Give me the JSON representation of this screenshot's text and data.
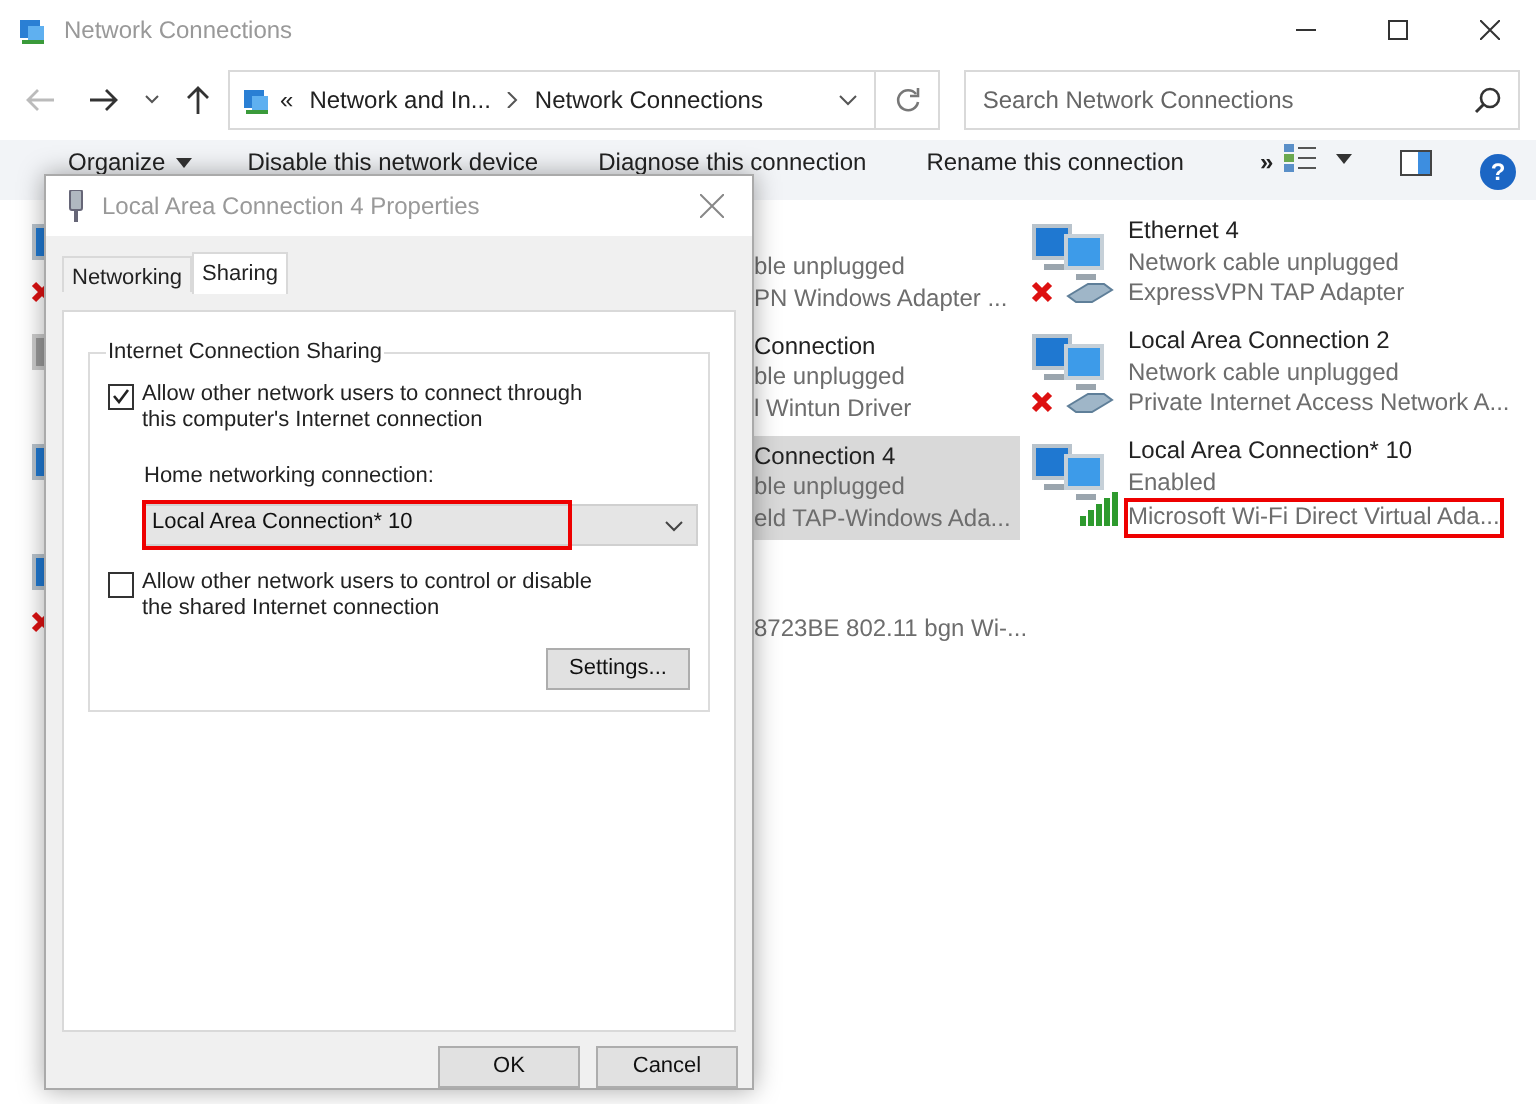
{
  "window": {
    "title": "Network Connections"
  },
  "address_bar": {
    "overflow": "«",
    "crumbs": [
      "Network and In...",
      "Network Connections"
    ]
  },
  "search": {
    "placeholder": "Search Network Connections"
  },
  "commands": [
    {
      "label": "Organize",
      "menu": true
    },
    {
      "label": "Disable this network device",
      "menu": false
    },
    {
      "label": "Diagnose this connection",
      "menu": false
    },
    {
      "label": "Rename this connection",
      "menu": false
    }
  ],
  "more_commands": "»",
  "help": "?",
  "columns": [
    {
      "items": [
        {
          "kind": "unplugged"
        },
        {
          "kind": "disabled"
        },
        {
          "kind": "enabled"
        },
        {
          "kind": "unplugged"
        }
      ]
    },
    {
      "items": [
        {
          "state": "ble unplugged",
          "device": "PN Windows Adapter ...",
          "selected": false
        },
        {
          "name": "Connection",
          "state": "ble unplugged",
          "device": "l Wintun Driver",
          "selected": false
        },
        {
          "name": "Connection 4",
          "state": "ble unplugged",
          "device": "eld TAP-Windows Ada...",
          "selected": true
        },
        {
          "device": "8723BE 802.11 bgn Wi-...",
          "selected": false
        }
      ]
    },
    {
      "items": [
        {
          "kind": "unplugged",
          "name": "Ethernet 4",
          "state": "Network cable unplugged",
          "device": "ExpressVPN TAP Adapter",
          "highlighted": false
        },
        {
          "kind": "unplugged",
          "name": "Local Area Connection 2",
          "state": "Network cable unplugged",
          "device": "Private Internet Access Network A...",
          "highlighted": false
        },
        {
          "kind": "enabled",
          "name": "Local Area Connection* 10",
          "state": "Enabled",
          "device": "Microsoft Wi-Fi Direct Virtual Ada...",
          "highlighted": true
        }
      ]
    }
  ],
  "dialog": {
    "title": "Local Area Connection 4 Properties",
    "tabs": [
      {
        "label": "Networking",
        "selected": false
      },
      {
        "label": "Sharing",
        "selected": true
      }
    ],
    "group_title": "Internet Connection Sharing",
    "allow_connect": {
      "label": "Allow other network users to connect through this computer's Internet connection",
      "checked": true
    },
    "home_label": "Home networking connection:",
    "home_select": {
      "value": "Local Area Connection* 10",
      "highlighted": true
    },
    "allow_control": {
      "label": "Allow other network users to control or disable the shared Internet connection",
      "checked": false
    },
    "settings_button": "Settings...",
    "buttons": [
      "OK",
      "Cancel"
    ]
  }
}
